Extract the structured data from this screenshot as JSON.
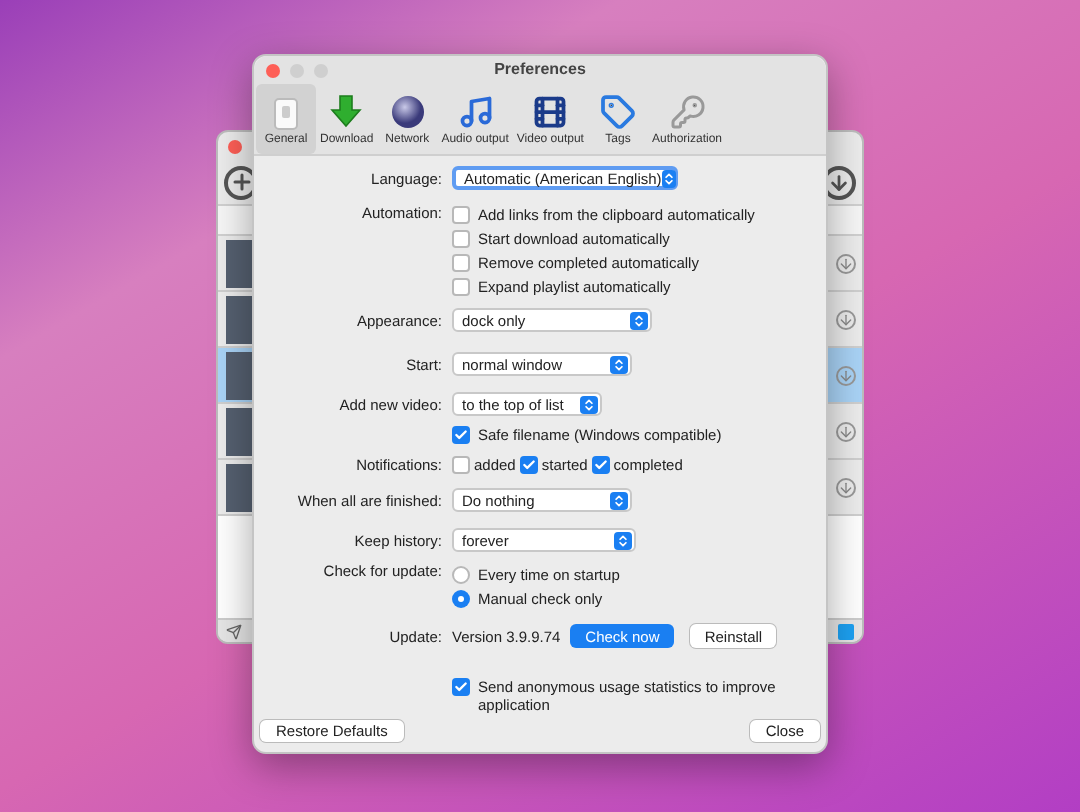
{
  "window": {
    "title": "Preferences"
  },
  "tabs": [
    {
      "label": "General",
      "selected": true
    },
    {
      "label": "Download",
      "selected": false
    },
    {
      "label": "Network",
      "selected": false
    },
    {
      "label": "Audio output",
      "selected": false
    },
    {
      "label": "Video output",
      "selected": false
    },
    {
      "label": "Tags",
      "selected": false
    },
    {
      "label": "Authorization",
      "selected": false
    }
  ],
  "settings": [
    {
      "kind": "select",
      "label": "Language:",
      "value": "Automatic (American English)",
      "focused": true
    },
    {
      "kind": "checks",
      "label": "Automation:",
      "options": [
        {
          "label": "Add links from the clipboard automatically",
          "checked": false
        },
        {
          "label": "Start download automatically",
          "checked": false
        },
        {
          "label": "Remove completed automatically",
          "checked": false
        },
        {
          "label": "Expand playlist automatically",
          "checked": false
        }
      ]
    },
    {
      "kind": "select",
      "label": "Appearance:",
      "value": "dock only",
      "focused": false
    },
    {
      "kind": "select",
      "label": "Start:",
      "value": "normal window",
      "focused": false
    },
    {
      "kind": "select",
      "label": "Add new video:",
      "value": "to the top of list",
      "focused": false
    },
    {
      "kind": "checks",
      "options": [
        {
          "label": "Safe filename (Windows compatible)",
          "checked": true
        }
      ]
    },
    {
      "kind": "inline_checks",
      "label": "Notifications:",
      "options": [
        {
          "label": "added",
          "checked": false
        },
        {
          "label": "started",
          "checked": true
        },
        {
          "label": "completed",
          "checked": true
        }
      ]
    },
    {
      "kind": "select",
      "label": "When all are finished:",
      "value": "Do nothing",
      "focused": false
    },
    {
      "kind": "select",
      "label": "Keep history:",
      "value": "forever",
      "focused": false
    },
    {
      "kind": "radios",
      "label": "Check for update:",
      "options": [
        {
          "label": "Every time on startup",
          "selected": false
        },
        {
          "label": "Manual check only",
          "selected": true
        }
      ]
    },
    {
      "kind": "update",
      "label": "Update:",
      "version": "Version 3.9.9.74",
      "primary": "Check now",
      "secondary": "Reinstall"
    },
    {
      "kind": "checks",
      "options": [
        {
          "label": "Send anonymous usage statistics to improve application",
          "checked": true
        }
      ]
    }
  ],
  "footer": {
    "left": "Restore Defaults",
    "right": "Close"
  },
  "back_window": {
    "rows": [
      {
        "selected": false
      },
      {
        "selected": false
      },
      {
        "selected": true
      },
      {
        "selected": false
      },
      {
        "selected": false
      }
    ]
  }
}
